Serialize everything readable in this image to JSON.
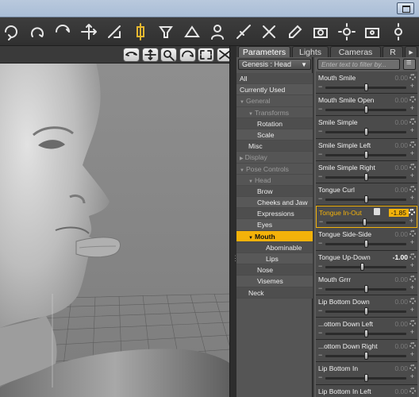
{
  "toolbar": {
    "icons": [
      "universal-tool-icon",
      "rotate-tool-icon",
      "orbit-tool-icon",
      "translate-tool-icon",
      "scale-tool-icon",
      "joint-editor-icon",
      "funnel-icon",
      "surface-selection-icon",
      "figure-icon",
      "node-weight-icon",
      "geometry-editor-icon",
      "edit-icon",
      "render-icon",
      "settings-icon",
      "camera-icon",
      "render-settings-icon"
    ]
  },
  "viewport": {
    "buttons": [
      "pan-icon",
      "translate-icon",
      "zoom-icon",
      "orbit-icon",
      "frame-icon",
      "maximize-icon"
    ]
  },
  "panel": {
    "tabs": [
      "Parameters",
      "Lights",
      "Cameras",
      "R"
    ],
    "node_selector": "Genesis : Head",
    "filter_placeholder": "Enter text to filter by..."
  },
  "tree": [
    {
      "label": "All",
      "kind": "row1",
      "indent": 0,
      "arrow": ""
    },
    {
      "label": "Currently Used",
      "kind": "row2",
      "indent": 0,
      "arrow": ""
    },
    {
      "label": "General",
      "kind": "group",
      "indent": 0,
      "arrow": "▼"
    },
    {
      "label": "Transforms",
      "kind": "group",
      "indent": 1,
      "arrow": "▼"
    },
    {
      "label": "Rotation",
      "kind": "row1",
      "indent": 2,
      "arrow": ""
    },
    {
      "label": "Scale",
      "kind": "row2",
      "indent": 2,
      "arrow": ""
    },
    {
      "label": "Misc",
      "kind": "row1",
      "indent": 1,
      "arrow": ""
    },
    {
      "label": "Display",
      "kind": "group",
      "indent": 0,
      "arrow": "▶"
    },
    {
      "label": "Pose Controls",
      "kind": "group",
      "indent": 0,
      "arrow": "▼"
    },
    {
      "label": "Head",
      "kind": "group",
      "indent": 1,
      "arrow": "▼"
    },
    {
      "label": "Brow",
      "kind": "row1",
      "indent": 2,
      "arrow": ""
    },
    {
      "label": "Cheeks and Jaw",
      "kind": "row2",
      "indent": 2,
      "arrow": ""
    },
    {
      "label": "Expressions",
      "kind": "row1",
      "indent": 2,
      "arrow": ""
    },
    {
      "label": "Eyes",
      "kind": "row2",
      "indent": 2,
      "arrow": ""
    },
    {
      "label": "Mouth",
      "kind": "selected",
      "indent": 1,
      "arrow": "▼"
    },
    {
      "label": "Abominable",
      "kind": "row1",
      "indent": 3,
      "arrow": ""
    },
    {
      "label": "Lips",
      "kind": "row2",
      "indent": 3,
      "arrow": ""
    },
    {
      "label": "Nose",
      "kind": "row1",
      "indent": 2,
      "arrow": ""
    },
    {
      "label": "Visemes",
      "kind": "row2",
      "indent": 2,
      "arrow": ""
    },
    {
      "label": "Neck",
      "kind": "row1",
      "indent": 1,
      "arrow": ""
    }
  ],
  "parameters": [
    {
      "name": "Mouth Smile",
      "value": "0.00",
      "pos": 0.5
    },
    {
      "name": "Mouth Smile Open",
      "value": "0.00",
      "pos": 0.5
    },
    {
      "name": "Smile Simple",
      "value": "0.00",
      "pos": 0.5
    },
    {
      "name": "Smile Simple Left",
      "value": "0.00",
      "pos": 0.5
    },
    {
      "name": "Smile Simple Right",
      "value": "0.00",
      "pos": 0.5
    },
    {
      "name": "Tongue Curl",
      "value": "0.00",
      "pos": 0.5
    },
    {
      "name": "Tongue In-Out",
      "value": "-1.85",
      "pos": 0.48,
      "highlight": true
    },
    {
      "name": "Tongue Side-Side",
      "value": "0.00",
      "pos": 0.5
    },
    {
      "name": "Tongue Up-Down",
      "value": "-1.00",
      "pos": 0.46,
      "strong": true
    },
    {
      "name": "Mouth Grrr",
      "value": "0.00",
      "pos": 0.5
    },
    {
      "name": "Lip Bottom Down",
      "value": "0.00",
      "pos": 0.5
    },
    {
      "name": "...ottom Down Left",
      "value": "0.00",
      "pos": 0.5
    },
    {
      "name": "...ottom Down Right",
      "value": "0.00",
      "pos": 0.5
    },
    {
      "name": "Lip Bottom In",
      "value": "0.00",
      "pos": 0.5
    },
    {
      "name": "Lip Bottom In Left",
      "value": "0.00",
      "pos": 0.5
    }
  ]
}
